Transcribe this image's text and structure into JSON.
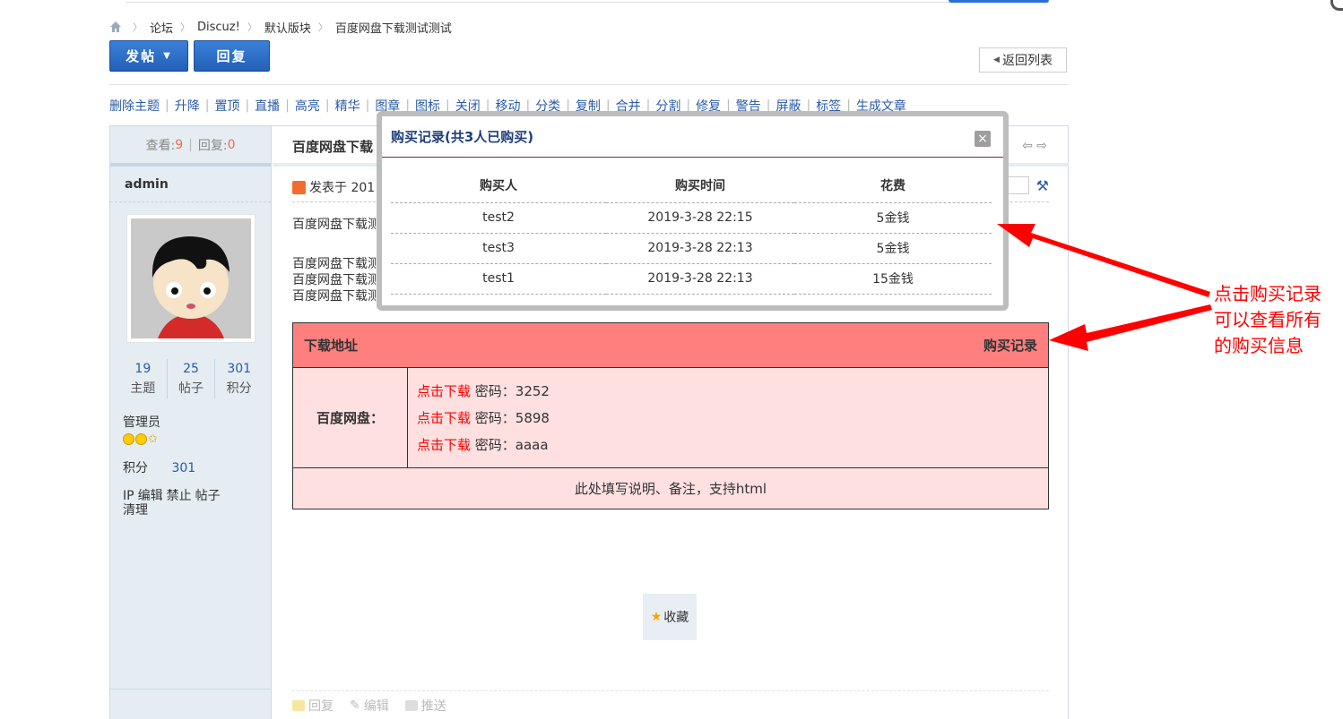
{
  "breadcrumb": {
    "items": [
      "论坛",
      "Discuz!",
      "默认版块",
      "百度网盘下载测试测试"
    ]
  },
  "toolbar": {
    "post_label": "发帖",
    "reply_label": "回复",
    "back_list_label": "返回列表"
  },
  "admin_tools": [
    "删除主题",
    "升降",
    "置顶",
    "直播",
    "高亮",
    "精华",
    "图章",
    "图标",
    "关闭",
    "移动",
    "分类",
    "复制",
    "合并",
    "分割",
    "修复",
    "警告",
    "屏蔽",
    "标签",
    "生成文章"
  ],
  "sidebar": {
    "views_label": "查看:",
    "views": "9",
    "replies_label": "回复:",
    "replies": "0",
    "username": "admin",
    "stats": [
      {
        "value": "19",
        "label": "主题"
      },
      {
        "value": "25",
        "label": "帖子"
      },
      {
        "value": "301",
        "label": "积分"
      }
    ],
    "group": "管理员",
    "credit_label": "积分",
    "credit_value": "301",
    "links": [
      "IP",
      "编辑",
      "禁止",
      "帖子",
      "清理"
    ]
  },
  "post": {
    "title": "百度网盘下载",
    "meta": "发表于 201",
    "lines": [
      "百度网盘下载测",
      "百度网盘下载测",
      "百度网盘下载测",
      "百度网盘下载测试测试百度网盘下载测试测试"
    ],
    "favorite_label": "收藏",
    "foot": {
      "reply": "回复",
      "edit": "编辑",
      "push": "推送"
    }
  },
  "download": {
    "header_label": "下载地址",
    "records_label": "购买记录",
    "disk_label": "百度网盘：",
    "link_text": "点击下载",
    "entries": [
      {
        "password": "密码：3252"
      },
      {
        "password": "密码：5898"
      },
      {
        "password": "密码：aaaa"
      }
    ],
    "note": "此处填写说明、备注，支持html"
  },
  "modal": {
    "title": "购买记录(共3人已购买)",
    "close": "×",
    "headers": [
      "购买人",
      "购买时间",
      "花费"
    ],
    "rows": [
      [
        "test2",
        "2019-3-28 22:15",
        "5金钱"
      ],
      [
        "test3",
        "2019-3-28 22:13",
        "5金钱"
      ],
      [
        "test1",
        "2019-3-28 22:13",
        "15金钱"
      ]
    ]
  },
  "annotation": {
    "lines": [
      "点击购买记录",
      "可以查看所有",
      "的购买信息"
    ]
  },
  "colors": {
    "accent_blue": "#2b6cc4",
    "download_header": "#ff7f7f",
    "download_body": "#ffe0e0",
    "link_red": "#ff0000",
    "annotation_red": "#ff0000"
  }
}
